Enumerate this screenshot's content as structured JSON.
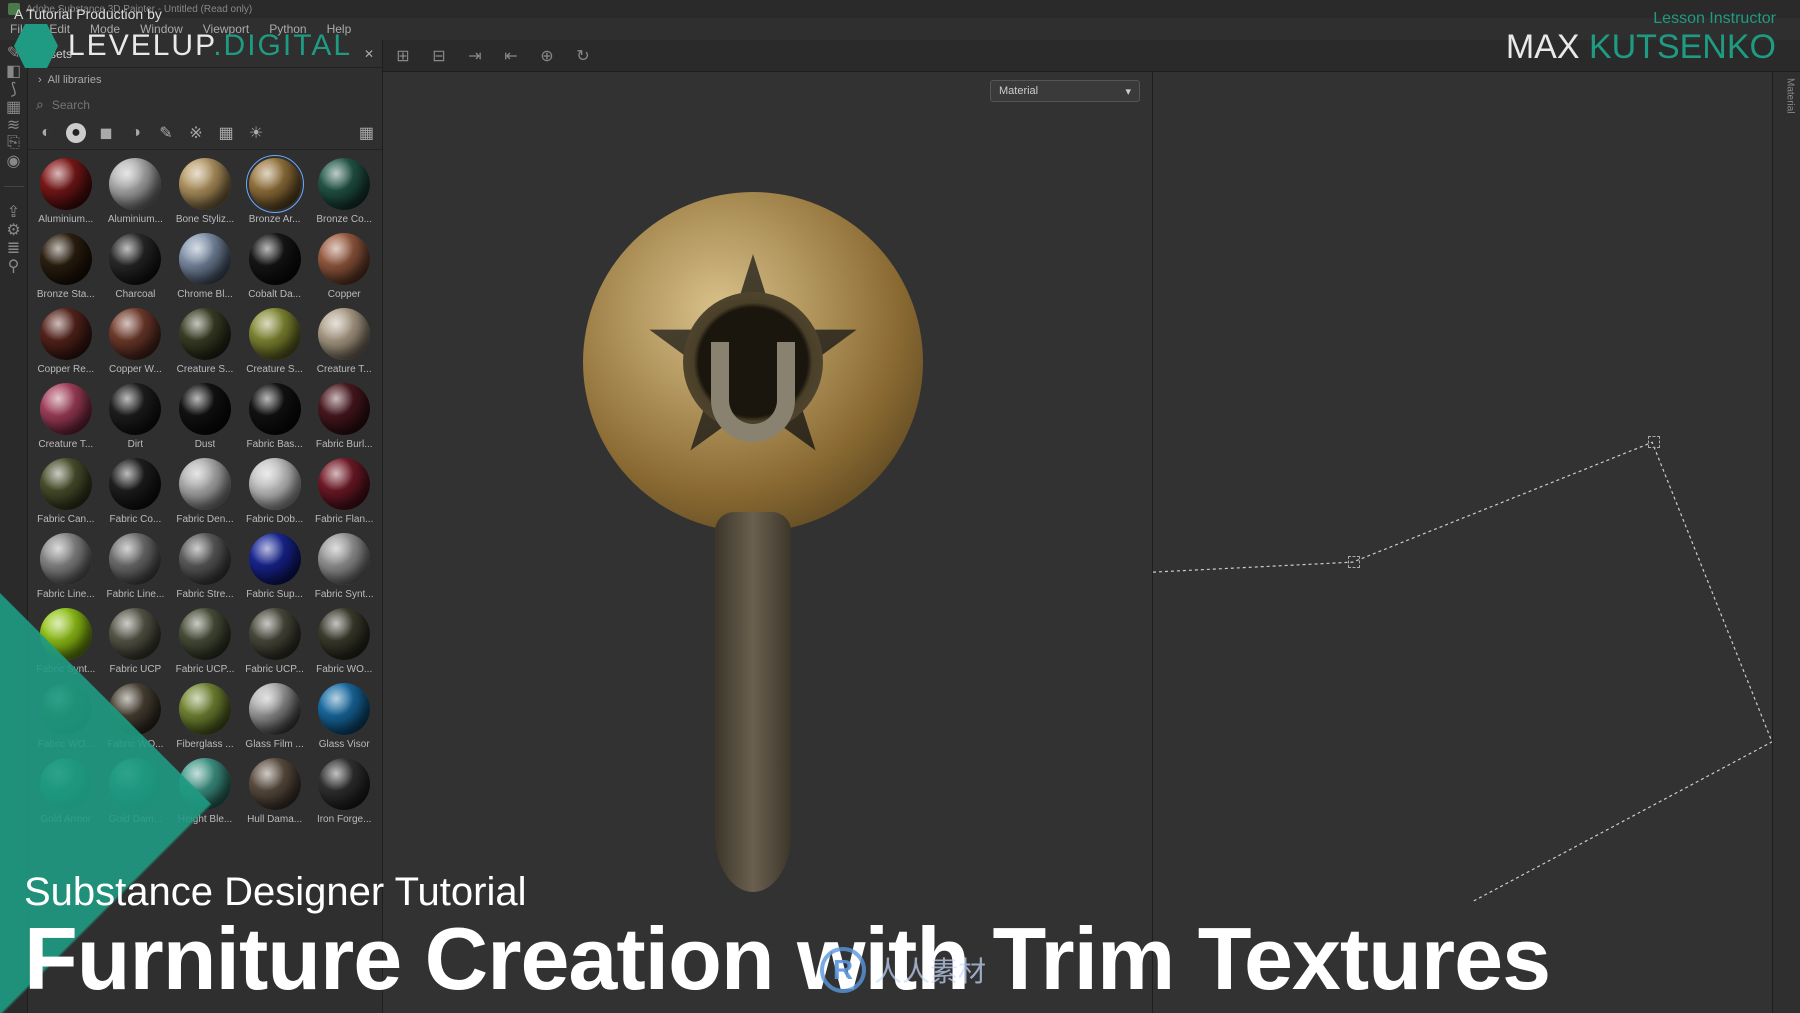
{
  "window": {
    "title": "Adobe Substance 3D Painter - Untitled (Read only)"
  },
  "menubar": {
    "items": [
      "File",
      "Edit",
      "Mode",
      "Window",
      "Viewport",
      "Python",
      "Help"
    ]
  },
  "left_tools": [
    {
      "name": "paint-tool-icon",
      "glyph": "✎"
    },
    {
      "name": "eraser-tool-icon",
      "glyph": "◧"
    },
    {
      "name": "projection-tool-icon",
      "glyph": "⟆"
    },
    {
      "name": "polyfill-tool-icon",
      "glyph": "▦"
    },
    {
      "name": "smudge-tool-icon",
      "glyph": "≋"
    },
    {
      "name": "clone-tool-icon",
      "glyph": "⎘"
    },
    {
      "name": "material-tool-icon",
      "glyph": "◉"
    }
  ],
  "left_tools2": [
    {
      "name": "export-icon",
      "glyph": "⇪"
    },
    {
      "name": "resource-icon",
      "glyph": "⚙"
    },
    {
      "name": "layers-icon",
      "glyph": "≣"
    },
    {
      "name": "settings-icon",
      "glyph": "⚲"
    }
  ],
  "assets": {
    "panel_label": "Assets",
    "pin_label": "✕",
    "breadcrumb_arrow": "›",
    "breadcrumb": "All libraries",
    "search_placeholder": "Search",
    "filters": [
      {
        "name": "filter-all-icon",
        "glyph": "◐",
        "active": false
      },
      {
        "name": "filter-material-icon",
        "glyph": "●",
        "active": true
      },
      {
        "name": "filter-smart-icon",
        "glyph": "◼",
        "active": false
      },
      {
        "name": "filter-mask-icon",
        "glyph": "◑",
        "active": false
      },
      {
        "name": "filter-brush-icon",
        "glyph": "✎",
        "active": false
      },
      {
        "name": "filter-alpha-icon",
        "glyph": "※",
        "active": false
      },
      {
        "name": "filter-texture-icon",
        "glyph": "▦",
        "active": false
      },
      {
        "name": "filter-env-icon",
        "glyph": "☀",
        "active": false
      }
    ],
    "materials": [
      {
        "label": "Aluminium...",
        "c1": "#a02020",
        "c2": "#300808"
      },
      {
        "label": "Aluminium...",
        "c1": "#d0d0d0",
        "c2": "#606060"
      },
      {
        "label": "Bone Styliz...",
        "c1": "#d2b37a",
        "c2": "#6a5530"
      },
      {
        "label": "Bronze Ar...",
        "c1": "#b89050",
        "c2": "#4a3818",
        "selected": true
      },
      {
        "label": "Bronze Co...",
        "c1": "#2e6a5a",
        "c2": "#0e2a22"
      },
      {
        "label": "Bronze Sta...",
        "c1": "#3a2a16",
        "c2": "#120a04"
      },
      {
        "label": "Charcoal",
        "c1": "#3a3a3a",
        "c2": "#0a0a0a"
      },
      {
        "label": "Chrome Bl...",
        "c1": "#a0b4d0",
        "c2": "#303a4a"
      },
      {
        "label": "Cobalt Da...",
        "c1": "#202020",
        "c2": "#050505"
      },
      {
        "label": "Copper",
        "c1": "#b87050",
        "c2": "#4a2a1c"
      },
      {
        "label": "Copper Re...",
        "c1": "#6a2e24",
        "c2": "#2a100c"
      },
      {
        "label": "Copper W...",
        "c1": "#8a4a38",
        "c2": "#3a1c14"
      },
      {
        "label": "Creature S...",
        "c1": "#4a5030",
        "c2": "#1a1c10"
      },
      {
        "label": "Creature S...",
        "c1": "#9aa040",
        "c2": "#4a5018"
      },
      {
        "label": "Creature T...",
        "c1": "#c8b8a0",
        "c2": "#6a6050"
      },
      {
        "label": "Creature T...",
        "c1": "#c05070",
        "c2": "#5a1c2e"
      },
      {
        "label": "Dirt",
        "c1": "#2a2a2a",
        "c2": "#0a0a0a"
      },
      {
        "label": "Dust",
        "c1": "#1a1a1a",
        "c2": "#050505"
      },
      {
        "label": "Fabric Bas...",
        "c1": "#1a1a1a",
        "c2": "#050505"
      },
      {
        "label": "Fabric Burl...",
        "c1": "#5a2028",
        "c2": "#240a0e"
      },
      {
        "label": "Fabric Can...",
        "c1": "#5a6038",
        "c2": "#282c16"
      },
      {
        "label": "Fabric Co...",
        "c1": "#2a2a2a",
        "c2": "#0a0a0a"
      },
      {
        "label": "Fabric Den...",
        "c1": "#c8c8c8",
        "c2": "#707070"
      },
      {
        "label": "Fabric Dob...",
        "c1": "#d8d8d8",
        "c2": "#888888"
      },
      {
        "label": "Fabric Flan...",
        "c1": "#8a2030",
        "c2": "#3a0c14"
      },
      {
        "label": "Fabric Line...",
        "c1": "#a0a0a0",
        "c2": "#505050"
      },
      {
        "label": "Fabric Line...",
        "c1": "#888888",
        "c2": "#3a3a3a"
      },
      {
        "label": "Fabric Stre...",
        "c1": "#707070",
        "c2": "#303030"
      },
      {
        "label": "Fabric Sup...",
        "c1": "#2030b0",
        "c2": "#0a1050"
      },
      {
        "label": "Fabric Synt...",
        "c1": "#b0b0b0",
        "c2": "#585858"
      },
      {
        "label": "Fabric Synt...",
        "c1": "#a8e020",
        "c2": "#5a7a08"
      },
      {
        "label": "Fabric UCP",
        "c1": "#6a6a5a",
        "c2": "#2e2e26"
      },
      {
        "label": "Fabric UCP...",
        "c1": "#5a6048",
        "c2": "#262a1e"
      },
      {
        "label": "Fabric UCP...",
        "c1": "#5a5a4a",
        "c2": "#26261e"
      },
      {
        "label": "Fabric WO...",
        "c1": "#4a4a3a",
        "c2": "#1e1e16"
      },
      {
        "label": "Fabric WO...",
        "c1": "#3a503a",
        "c2": "#162016"
      },
      {
        "label": "Fabric WO...",
        "c1": "#5a5040",
        "c2": "#26221a"
      },
      {
        "label": "Fiberglass ...",
        "c1": "#8aa040",
        "c2": "#3e4a18"
      },
      {
        "label": "Glass Film ...",
        "c1": "#e0e0e0",
        "c2": "#202020"
      },
      {
        "label": "Glass Visor",
        "c1": "#2080c0",
        "c2": "#083a5a"
      },
      {
        "label": "Gold Armor",
        "c1": "#30a090",
        "c2": "#104a40"
      },
      {
        "label": "Gold Dam...",
        "c1": "#40a898",
        "c2": "#185048"
      },
      {
        "label": "Height Ble...",
        "c1": "#50b0a0",
        "c2": "#20584e"
      },
      {
        "label": "Hull Dama...",
        "c1": "#706050",
        "c2": "#302820"
      },
      {
        "label": "Iron Forge...",
        "c1": "#404040",
        "c2": "#141414"
      }
    ]
  },
  "viewport_toolbar": [
    {
      "name": "grid-perspective-icon",
      "glyph": "⊞"
    },
    {
      "name": "grid-ortho-icon",
      "glyph": "⊟"
    },
    {
      "name": "snap-next-icon",
      "glyph": "⇥"
    },
    {
      "name": "snap-prev-icon",
      "glyph": "⇤"
    },
    {
      "name": "add-view-icon",
      "glyph": "⊕"
    },
    {
      "name": "reset-view-icon",
      "glyph": "↻"
    }
  ],
  "viewport": {
    "dropdown_label": "Material",
    "dropdown_caret": "▾"
  },
  "right_panel_label": "Material",
  "overlay": {
    "production_line": "A Tutorial Production by",
    "brand_a": "LEVELUP",
    "brand_b": ".DIGITAL",
    "instructor_label": "Lesson Instructor",
    "instructor_first": "MAX ",
    "instructor_last": "KUTSENKO",
    "subtitle": "Substance Designer Tutorial",
    "title": "Furniture Creation with Trim Textures",
    "watermark": "人人素材",
    "watermark_badge": "R"
  }
}
